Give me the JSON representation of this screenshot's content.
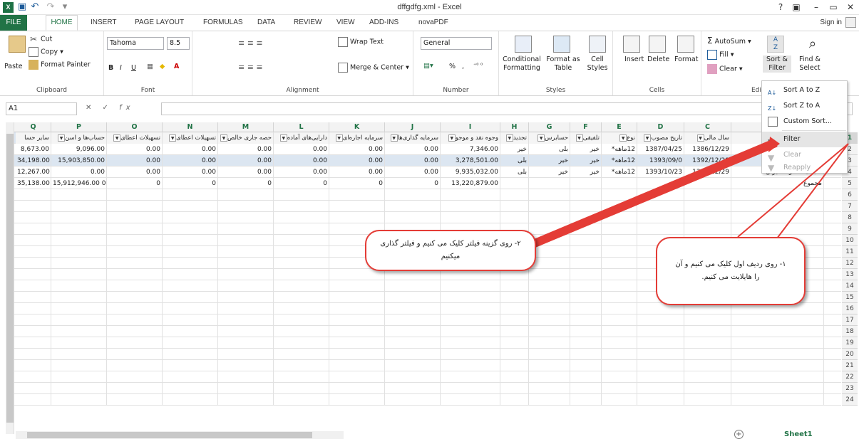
{
  "app": {
    "doc_title": "dffgdfg.xml - Excel",
    "sign_in": "Sign in",
    "help": "?",
    "window_controls": [
      "?",
      "▣",
      "–",
      "🗗",
      "✕"
    ]
  },
  "menu": {
    "tabs": [
      "FILE",
      "HOME",
      "INSERT",
      "PAGE LAYOUT",
      "FORMULAS",
      "DATA",
      "REVIEW",
      "VIEW",
      "ADD-INS",
      "novaPDF"
    ],
    "active": "HOME"
  },
  "ribbon": {
    "clipboard": {
      "label": "Clipboard",
      "paste": "Paste",
      "cut": "Cut",
      "copy": "Copy",
      "format_painter": "Format Painter"
    },
    "font": {
      "label": "Font",
      "name": "Tahoma",
      "size": "8.5",
      "bold": "B",
      "italic": "I",
      "underline": "U"
    },
    "alignment": {
      "label": "Alignment",
      "wrap_text": "Wrap Text",
      "merge_center": "Merge & Center"
    },
    "number": {
      "label": "Number",
      "format": "General",
      "percent": "%",
      "comma": ","
    },
    "styles": {
      "label": "Styles",
      "conditional": "Conditional Formatting",
      "format_table": "Format as Table",
      "cell_styles": "Cell Styles"
    },
    "cells": {
      "label": "Cells",
      "insert": "Insert",
      "delete": "Delete",
      "format": "Format"
    },
    "editing": {
      "label": "Editi",
      "autosum": "AutoSum",
      "fill": "Fill",
      "clear": "Clear",
      "sort_filter": "Sort & Filter",
      "find_select": "Find & Select"
    }
  },
  "formula_bar": {
    "name_box": "A1",
    "fx": "fx",
    "value": ""
  },
  "columns": [
    "Q",
    "P",
    "O",
    "N",
    "M",
    "L",
    "K",
    "J",
    "I",
    "H",
    "G",
    "F",
    "E",
    "D",
    "C",
    "B"
  ],
  "header_row": [
    "سایر حسا",
    "حساب‌ها و اسن",
    "تسهیلات اعطای",
    "تسهیلات اعطای",
    "حصه جاری خالص",
    "دارایی‌های آماده",
    "سرمایه اجاره‌ای",
    "سرمایه گذاری‌ها",
    "وجوه نقد و موجو",
    "تجدید",
    "حسابرس",
    "تلفیقی",
    "نوع",
    "تاریخ مصوب",
    "سال مالی",
    ""
  ],
  "rows": [
    [
      "8,673.00",
      "9,096.00",
      "0.00",
      "0.00",
      "0.00",
      "0.00",
      "0.00",
      "0.00",
      "7,346.00",
      "خیر",
      "بلی",
      "خیر",
      "12ماهه*",
      "1387/04/25",
      "1386/12/29",
      ""
    ],
    [
      "34,198.00",
      "15,903,850.00",
      "0.00",
      "0.00",
      "0.00",
      "0.00",
      "0.00",
      "0.00",
      "3,278,501.00",
      "بلی",
      "خیر",
      "خیر",
      "12ماهه*",
      "1393/09/0",
      "1392/12/29",
      ""
    ],
    [
      "12,267.00",
      "0.00",
      "0.00",
      "0.00",
      "0.00",
      "0.00",
      "0.00",
      "0.00",
      "9,935,032.00",
      "بلی",
      "خیر",
      "خیر",
      "12ماهه*",
      "1393/10/23",
      "1392/12/29",
      "3 بانک صادرات ایران"
    ],
    [
      "35,138.00",
      "15,912,946.00 0",
      "0",
      "0",
      "0",
      "0",
      "0",
      "0",
      "13,220,879.00",
      "",
      "",
      "",
      "",
      "",
      "",
      "مجموع"
    ]
  ],
  "row_numbers": [
    "1",
    "2",
    "3",
    "4",
    "5",
    "6",
    "7",
    "8",
    "9",
    "10",
    "11",
    "12",
    "13",
    "14",
    "15",
    "16",
    "17",
    "18",
    "19",
    "20",
    "21",
    "22",
    "23",
    "24"
  ],
  "sheet": {
    "name": "Sheet1"
  },
  "sort_menu": {
    "items": [
      {
        "label": "Sort A to Z",
        "enabled": true
      },
      {
        "label": "Sort Z to A",
        "enabled": true
      },
      {
        "label": "Custom Sort...",
        "enabled": true
      },
      {
        "label": "Filter",
        "enabled": true
      },
      {
        "label": "Clear",
        "enabled": false
      },
      {
        "label": "Reapply",
        "enabled": false
      }
    ]
  },
  "annotations": {
    "callout_filter": "۲- روی گزینه فیلتر کلیک می کنیم و فیلتر گذاری میکنیم",
    "callout_row": "۱- روی ردیف اول کلیک می کنیم و آن را هایلایت می کنیم."
  },
  "colors": {
    "excel_green": "#217346",
    "arrow_red": "#e43c36",
    "selection": "#dce6f1"
  }
}
